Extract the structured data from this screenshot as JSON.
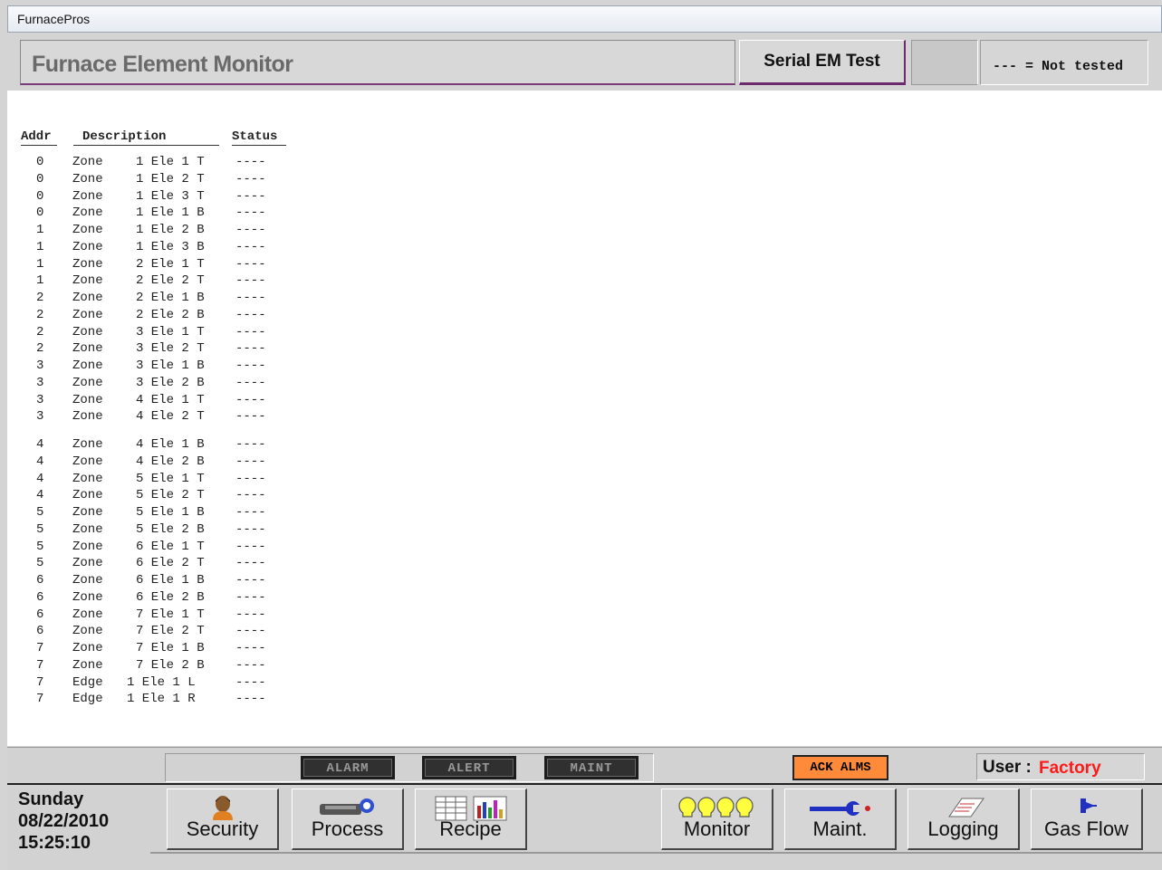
{
  "app": {
    "window_title": "FurnacePros"
  },
  "header": {
    "title": "Furnace Element Monitor",
    "serial_btn": "Serial EM Test",
    "legend": "--- = Not tested"
  },
  "table": {
    "headers": {
      "addr": "Addr",
      "description": "Description",
      "status": "Status"
    },
    "rows": [
      {
        "addr": "0",
        "type": "Zone",
        "desc": "1 Ele 1 T",
        "status": "----"
      },
      {
        "addr": "0",
        "type": "Zone",
        "desc": "1 Ele 2 T",
        "status": "----"
      },
      {
        "addr": "0",
        "type": "Zone",
        "desc": "1 Ele 3 T",
        "status": "----"
      },
      {
        "addr": "0",
        "type": "Zone",
        "desc": "1 Ele 1 B",
        "status": "----"
      },
      {
        "addr": "1",
        "type": "Zone",
        "desc": "1 Ele 2 B",
        "status": "----"
      },
      {
        "addr": "1",
        "type": "Zone",
        "desc": "1 Ele 3 B",
        "status": "----"
      },
      {
        "addr": "1",
        "type": "Zone",
        "desc": "2 Ele 1 T",
        "status": "----"
      },
      {
        "addr": "1",
        "type": "Zone",
        "desc": "2 Ele 2 T",
        "status": "----"
      },
      {
        "addr": "2",
        "type": "Zone",
        "desc": "2 Ele 1 B",
        "status": "----"
      },
      {
        "addr": "2",
        "type": "Zone",
        "desc": "2 Ele 2 B",
        "status": "----"
      },
      {
        "addr": "2",
        "type": "Zone",
        "desc": "3 Ele 1 T",
        "status": "----"
      },
      {
        "addr": "2",
        "type": "Zone",
        "desc": "3 Ele 2 T",
        "status": "----"
      },
      {
        "addr": "3",
        "type": "Zone",
        "desc": "3 Ele 1 B",
        "status": "----"
      },
      {
        "addr": "3",
        "type": "Zone",
        "desc": "3 Ele 2 B",
        "status": "----"
      },
      {
        "addr": "3",
        "type": "Zone",
        "desc": "4 Ele 1 T",
        "status": "----"
      },
      {
        "addr": "3",
        "type": "Zone",
        "desc": "4 Ele 2 T",
        "status": "----"
      },
      {
        "addr": "4",
        "type": "Zone",
        "desc": "4 Ele 1 B",
        "status": "----"
      },
      {
        "addr": "4",
        "type": "Zone",
        "desc": "4 Ele 2 B",
        "status": "----"
      },
      {
        "addr": "4",
        "type": "Zone",
        "desc": "5 Ele 1 T",
        "status": "----"
      },
      {
        "addr": "4",
        "type": "Zone",
        "desc": "5 Ele 2 T",
        "status": "----"
      },
      {
        "addr": "5",
        "type": "Zone",
        "desc": "5 Ele 1 B",
        "status": "----"
      },
      {
        "addr": "5",
        "type": "Zone",
        "desc": "5 Ele 2 B",
        "status": "----"
      },
      {
        "addr": "5",
        "type": "Zone",
        "desc": "6 Ele 1 T",
        "status": "----"
      },
      {
        "addr": "5",
        "type": "Zone",
        "desc": "6 Ele 2 T",
        "status": "----"
      },
      {
        "addr": "6",
        "type": "Zone",
        "desc": "6 Ele 1 B",
        "status": "----"
      },
      {
        "addr": "6",
        "type": "Zone",
        "desc": "6 Ele 2 B",
        "status": "----"
      },
      {
        "addr": "6",
        "type": "Zone",
        "desc": "7 Ele 1 T",
        "status": "----"
      },
      {
        "addr": "6",
        "type": "Zone",
        "desc": "7 Ele 2 T",
        "status": "----"
      },
      {
        "addr": "7",
        "type": "Zone",
        "desc": "7 Ele 1 B",
        "status": "----"
      },
      {
        "addr": "7",
        "type": "Zone",
        "desc": "7 Ele 2 B",
        "status": "----"
      },
      {
        "addr": "7",
        "type": "Edge",
        "desc": "1 Ele 1 L",
        "status": "----"
      },
      {
        "addr": "7",
        "type": "Edge",
        "desc": "1 Ele 1 R",
        "status": "----"
      }
    ]
  },
  "alarm_bar": {
    "alarm": "ALARM",
    "alert": "ALERT",
    "maint": "MAINT",
    "ack": "ACK ALMS",
    "user_label": "User :",
    "user_value": "Factory"
  },
  "status": {
    "day": "Sunday",
    "date": "08/22/2010",
    "time": "15:25:10"
  },
  "nav": {
    "security": "Security",
    "process": "Process",
    "recipe": "Recipe",
    "monitor": "Monitor",
    "maint": "Maint.",
    "logging": "Logging",
    "gasflow": "Gas Flow"
  },
  "colors": {
    "ack_bg": "#ff8a3a",
    "user_value": "#ff1a1a",
    "header_accent": "#6c2a6c"
  }
}
